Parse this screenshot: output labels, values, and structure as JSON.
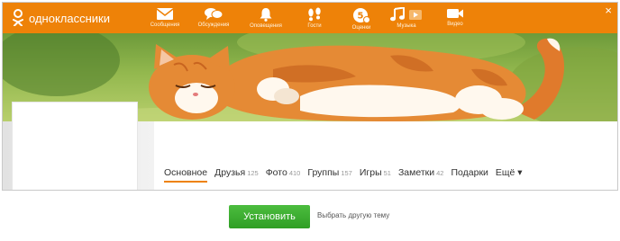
{
  "app": {
    "logo_text": "одноклассники",
    "close_symbol": "×"
  },
  "nav": {
    "items": [
      {
        "label": "Сообщения",
        "icon": "envelope-icon"
      },
      {
        "label": "Обсуждения",
        "icon": "chat-bubbles-icon"
      },
      {
        "label": "Оповещения",
        "icon": "bell-icon"
      },
      {
        "label": "Гости",
        "icon": "footprints-icon"
      },
      {
        "label": "Оценки",
        "icon": "rating-badge-icon"
      },
      {
        "label": "Музыка",
        "icon": "music-note-icon"
      },
      {
        "label": "Видео",
        "icon": "video-camera-icon"
      }
    ]
  },
  "profile_tabs": [
    {
      "label": "Основное",
      "count": ""
    },
    {
      "label": "Друзья",
      "count": "125"
    },
    {
      "label": "Фото",
      "count": "410"
    },
    {
      "label": "Группы",
      "count": "157"
    },
    {
      "label": "Игры",
      "count": "51"
    },
    {
      "label": "Заметки",
      "count": "42"
    },
    {
      "label": "Подарки",
      "count": ""
    },
    {
      "label": "Ещё ▾",
      "count": ""
    }
  ],
  "actions": {
    "install_label": "Установить",
    "choose_other_label": "Выбрать другую тему"
  },
  "colors": {
    "brand": "#ee8208",
    "install": "#3aa92d"
  }
}
